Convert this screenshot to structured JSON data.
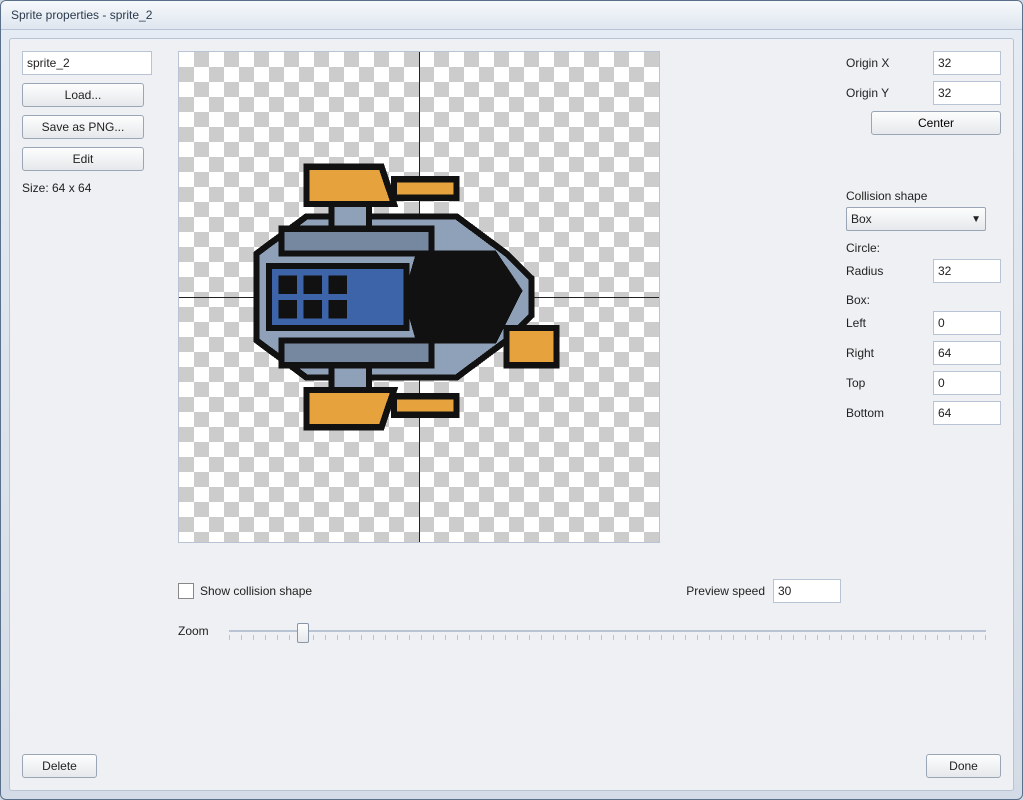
{
  "window": {
    "title": "Sprite properties - sprite_2"
  },
  "left": {
    "name_value": "sprite_2",
    "load_label": "Load...",
    "save_png_label": "Save as PNG...",
    "edit_label": "Edit",
    "size_label": "Size: 64 x 64"
  },
  "origin": {
    "x_label": "Origin X",
    "x_value": "32",
    "y_label": "Origin Y",
    "y_value": "32",
    "center_label": "Center"
  },
  "collision": {
    "title": "Collision shape",
    "shape_value": "Box",
    "circle_label": "Circle:",
    "radius_label": "Radius",
    "radius_value": "32",
    "box_label": "Box:",
    "left_label": "Left",
    "left_value": "0",
    "right_label": "Right",
    "right_value": "64",
    "top_label": "Top",
    "top_value": "0",
    "bottom_label": "Bottom",
    "bottom_value": "64"
  },
  "preview": {
    "show_collision_label": "Show collision shape",
    "show_collision_checked": false,
    "speed_label": "Preview speed",
    "speed_value": "30",
    "zoom_label": "Zoom"
  },
  "footer": {
    "delete_label": "Delete",
    "done_label": "Done"
  }
}
